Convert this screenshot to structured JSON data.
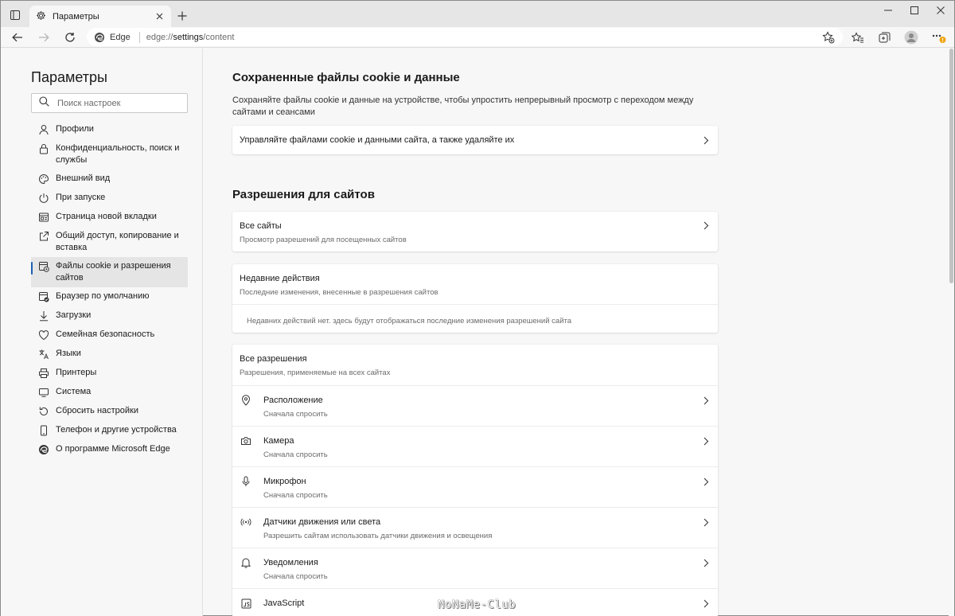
{
  "tab": {
    "title": "Параметры"
  },
  "toolbar": {
    "site_label": "Edge",
    "url_prefix": "edge://",
    "url_main": "settings",
    "url_rest": "/content"
  },
  "sidebar": {
    "title": "Параметры",
    "search_placeholder": "Поиск настроек",
    "items": [
      {
        "label": "Профили",
        "icon": "profile-icon"
      },
      {
        "label": "Конфиденциальность, поиск и службы",
        "icon": "lock-icon"
      },
      {
        "label": "Внешний вид",
        "icon": "appearance-icon"
      },
      {
        "label": "При запуске",
        "icon": "power-icon"
      },
      {
        "label": "Страница новой вкладки",
        "icon": "newtab-page-icon"
      },
      {
        "label": "Общий доступ, копирование и вставка",
        "icon": "share-icon"
      },
      {
        "label": "Файлы cookie и разрешения сайтов",
        "icon": "cookie-settings-icon",
        "active": true
      },
      {
        "label": "Браузер по умолчанию",
        "icon": "default-browser-icon"
      },
      {
        "label": "Загрузки",
        "icon": "download-icon"
      },
      {
        "label": "Семейная безопасность",
        "icon": "family-icon"
      },
      {
        "label": "Языки",
        "icon": "language-icon"
      },
      {
        "label": "Принтеры",
        "icon": "printer-icon"
      },
      {
        "label": "Система",
        "icon": "system-icon"
      },
      {
        "label": "Сбросить настройки",
        "icon": "reset-icon"
      },
      {
        "label": "Телефон и другие устройства",
        "icon": "phone-icon"
      },
      {
        "label": "О программе Microsoft Edge",
        "icon": "edge-logo-icon"
      }
    ]
  },
  "cookies": {
    "heading": "Сохраненные файлы cookie и данные",
    "description": "Сохраняйте файлы cookie и данные на устройстве, чтобы упростить непрерывный просмотр с переходом между сайтами и сеансами",
    "manage_label": "Управляйте файлами cookie и данными сайта, а также удаляйте их"
  },
  "permissions": {
    "heading": "Разрешения для сайтов",
    "all_sites": {
      "title": "Все сайты",
      "subtitle": "Просмотр разрешений для посещенных сайтов"
    },
    "recent": {
      "title": "Недавние действия",
      "subtitle": "Последние изменения, внесенные в разрешения сайтов",
      "empty": "Недавних действий нет. здесь будут отображаться последние изменения разрешений сайта"
    },
    "all_perms": {
      "title": "Все разрешения",
      "subtitle": "Разрешения, применяемые на всех сайтах",
      "items": [
        {
          "title": "Расположение",
          "subtitle": "Сначала спросить",
          "icon": "location-icon"
        },
        {
          "title": "Камера",
          "subtitle": "Сначала спросить",
          "icon": "camera-icon"
        },
        {
          "title": "Микрофон",
          "subtitle": "Сначала спросить",
          "icon": "microphone-icon"
        },
        {
          "title": "Датчики движения или света",
          "subtitle": "Разрешить сайтам использовать датчики движения и освещения",
          "icon": "sensors-icon"
        },
        {
          "title": "Уведомления",
          "subtitle": "Сначала спросить",
          "icon": "bell-icon"
        },
        {
          "title": "JavaScript",
          "subtitle": "",
          "icon": "javascript-icon"
        }
      ]
    }
  },
  "watermark": "NoNaMe-Club"
}
